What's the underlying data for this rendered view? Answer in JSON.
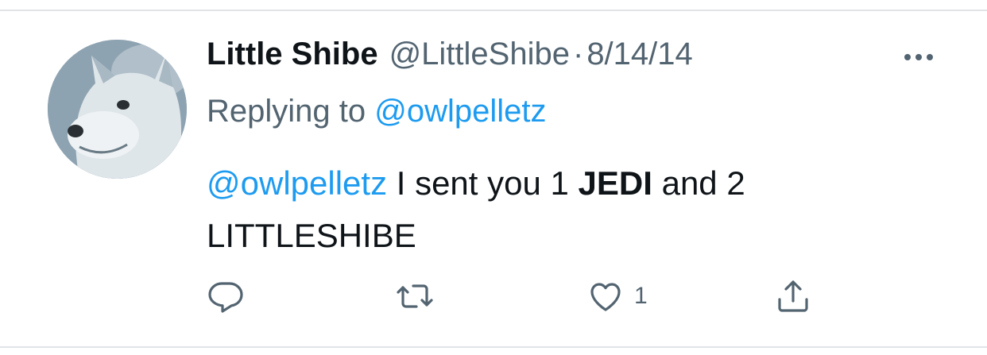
{
  "tweet": {
    "display_name": "Little Shibe",
    "handle": "@LittleShibe",
    "separator": "·",
    "date": "8/14/14",
    "replying_prefix": "Replying to",
    "replying_to": "@owlpelletz",
    "body": {
      "mention": "@owlpelletz",
      "text_1": " I sent you 1 ",
      "bold_1": "JEDI",
      "text_2": " and 2 LITTLESHIBE"
    },
    "actions": {
      "like_count": "1"
    }
  },
  "icons": {
    "more": "more-horizontal-icon",
    "reply": "reply-bubble-icon",
    "retweet": "retweet-icon",
    "like": "heart-icon",
    "share": "share-upload-icon"
  },
  "colors": {
    "link": "#1d9bf0",
    "secondary_text": "#536471",
    "primary_text": "#0f1419"
  }
}
